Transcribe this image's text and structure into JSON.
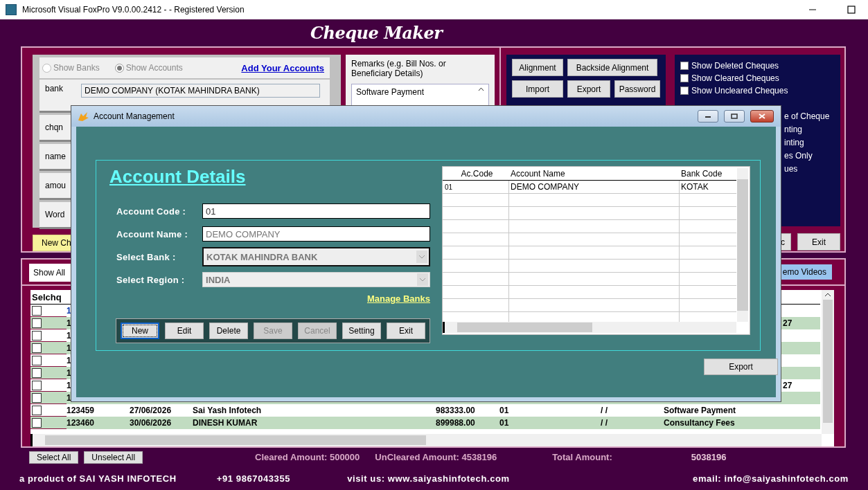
{
  "window": {
    "title": "Microsoft Visual FoxPro V9.0.00.2412 - - Registered Version"
  },
  "app_title": "Cheque Maker",
  "cheque_form": {
    "radios": [
      {
        "label": "Show Banks",
        "selected": false
      },
      {
        "label": "Show Accounts",
        "selected": true
      }
    ],
    "add_accounts_link": "Add Your Accounts",
    "fields": [
      {
        "label": "bank",
        "value": "DEMO COMPANY (KOTAK MAHINDRA BANK)"
      },
      {
        "label": "chqn"
      },
      {
        "label": "name"
      },
      {
        "label": "amou"
      },
      {
        "label": "Word"
      }
    ],
    "new_button": "New Ch"
  },
  "remarks": {
    "label": "Remarks (e.g. Bill Nos. or Beneficiary Details)",
    "value": "Software Payment"
  },
  "tool_buttons": [
    [
      "Alignment",
      "Backside Alignment"
    ],
    [
      "Import",
      "Export",
      "Password"
    ]
  ],
  "options": [
    {
      "kind": "checkbox",
      "label": "Show Deleted Cheques",
      "checked": false
    },
    {
      "kind": "checkbox",
      "label": "Show Cleared Cheques",
      "checked": false
    },
    {
      "kind": "checkbox",
      "label": "Show Uncleared Cheques",
      "checked": false
    },
    {
      "kind": "partial",
      "label": "e of Cheque"
    },
    {
      "kind": "partial",
      "label": "nting"
    },
    {
      "kind": "partial",
      "label": "inting"
    },
    {
      "kind": "partial",
      "label": "es Only"
    },
    {
      "kind": "partial",
      "label": "ues"
    }
  ],
  "side_buttons": [
    "c",
    "Exit"
  ],
  "list": {
    "filter": "Show All",
    "videos_button": "emo Videos",
    "columns": [
      "Selchq"
    ],
    "rows": [
      {
        "checked": false,
        "selected": true,
        "chqno": "1"
      },
      {
        "checked": false,
        "selected": false,
        "chqno": "1",
        "column_9": "27"
      },
      {
        "checked": false,
        "selected": false,
        "chqno": "1"
      },
      {
        "checked": false,
        "selected": false,
        "chqno": "1"
      },
      {
        "checked": false,
        "selected": false,
        "chqno": "1"
      },
      {
        "checked": false,
        "selected": false,
        "chqno": "1"
      },
      {
        "checked": false,
        "selected": false,
        "chqno": "1",
        "column_9": "27"
      },
      {
        "checked": false,
        "selected": false,
        "chqno": "1"
      },
      {
        "checked": false,
        "selected": false,
        "chqno": "123459",
        "date": "27/06/2026",
        "payee": "Sai Yash Infotech",
        "amount": "983333.00",
        "code": "01",
        "cleared": "/  /",
        "remarks": "Software Payment"
      },
      {
        "checked": false,
        "selected": false,
        "chqno": "123460",
        "date": "30/06/2026",
        "payee": "DINESH KUMAR",
        "amount": "899988.00",
        "code": "01",
        "cleared": "/  /",
        "remarks": "Consultancy Fees"
      }
    ]
  },
  "summary": {
    "buttons": [
      "Select All",
      "Unselect All"
    ],
    "cleared": "Cleared Amount: 500000",
    "uncleared": "UnCleared Amount: 4538196",
    "total_label": "Total Amount:",
    "total": "5038196"
  },
  "footer": [
    "a product of  SAI YASH INFOTECH",
    "+91 9867043355",
    "visit us: www.saiyashinfotech.com",
    "email: info@saiyashinfotech.com"
  ],
  "dialog": {
    "title": "Account Management",
    "heading": "Account Details",
    "fields": [
      {
        "kind": "text",
        "label": "Account Code :",
        "value": "01",
        "disabled": false
      },
      {
        "kind": "text",
        "label": "Account Name :",
        "value": "DEMO COMPANY",
        "disabled": true
      },
      {
        "kind": "select",
        "label": "Select Bank :",
        "value": "KOTAK MAHINDRA BANK",
        "disabled": true
      },
      {
        "kind": "select",
        "label": "Select Region :",
        "value": "INDIA",
        "disabled": true
      }
    ],
    "manage_link": "Manage Banks",
    "buttons": [
      {
        "label": "New",
        "disabled": false,
        "focused": true
      },
      {
        "label": "Edit",
        "disabled": false,
        "focused": false
      },
      {
        "label": "Delete",
        "disabled": false,
        "focused": false
      },
      {
        "label": "Save",
        "disabled": true,
        "focused": false
      },
      {
        "label": "Cancel",
        "disabled": true,
        "focused": false
      },
      {
        "label": "Setting",
        "disabled": false,
        "focused": false
      },
      {
        "label": "Exit",
        "disabled": false,
        "focused": false
      }
    ],
    "grid": {
      "columns": [
        "Ac.Code",
        "Account Name",
        "Bank Code"
      ],
      "rows": [
        [
          "01",
          "DEMO COMPANY",
          "KOTAK"
        ]
      ]
    },
    "export_button": "Export"
  }
}
